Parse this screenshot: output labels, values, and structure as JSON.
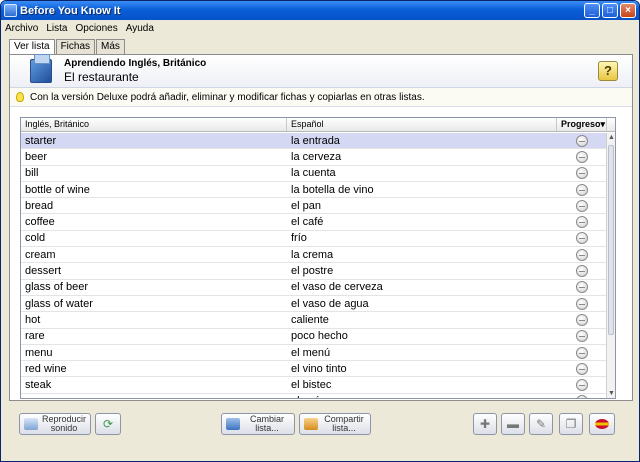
{
  "window": {
    "title": "Before You Know It"
  },
  "menu": [
    "Archivo",
    "Lista",
    "Opciones",
    "Ayuda"
  ],
  "tabs": [
    {
      "label": "Ver lista",
      "active": true
    },
    {
      "label": "Fichas",
      "active": false
    },
    {
      "label": "Más",
      "active": false
    }
  ],
  "header": {
    "subtitle": "Aprendiendo Inglés, Británico",
    "list_name": "El restaurante",
    "help_label": "?"
  },
  "tip": "Con la versión Deluxe podrá añadir, eliminar y modificar fichas y copiarlas en otras listas.",
  "table": {
    "columns": [
      "Inglés, Británico",
      "Español",
      "Progreso"
    ],
    "progress_sort_glyph": "▾",
    "rows": [
      {
        "en": "starter",
        "es": "la entrada"
      },
      {
        "en": "beer",
        "es": "la cerveza"
      },
      {
        "en": "bill",
        "es": "la cuenta"
      },
      {
        "en": "bottle of wine",
        "es": "la botella de vino"
      },
      {
        "en": "bread",
        "es": "el pan"
      },
      {
        "en": "coffee",
        "es": "el café"
      },
      {
        "en": "cold",
        "es": "frío"
      },
      {
        "en": "cream",
        "es": "la crema"
      },
      {
        "en": "dessert",
        "es": "el postre"
      },
      {
        "en": "glass of beer",
        "es": "el vaso de cerveza"
      },
      {
        "en": "glass of water",
        "es": "el vaso de agua"
      },
      {
        "en": "hot",
        "es": "caliente"
      },
      {
        "en": "rare",
        "es": "poco hecho"
      },
      {
        "en": "menu",
        "es": "el menú"
      },
      {
        "en": "red wine",
        "es": "el vino tinto"
      },
      {
        "en": "steak",
        "es": "el bistec"
      },
      {
        "en": "sugar",
        "es": "el azúcar"
      }
    ],
    "selected_index": 0
  },
  "bottom": {
    "play_sound": "Reproducir sonido",
    "change_list": "Cambiar lista...",
    "share_list": "Compartir lista..."
  },
  "icons": {
    "speaker": "speaker-icon",
    "refresh": "refresh-icon",
    "list": "list-icon",
    "share": "share-icon",
    "add": "add-icon",
    "remove": "remove-icon",
    "edit": "edit-icon",
    "copy": "copy-icon",
    "flag": "flag-icon"
  },
  "colors": {
    "titlebar": "#0a5fd8",
    "selected_row": "#d4d8f2"
  }
}
